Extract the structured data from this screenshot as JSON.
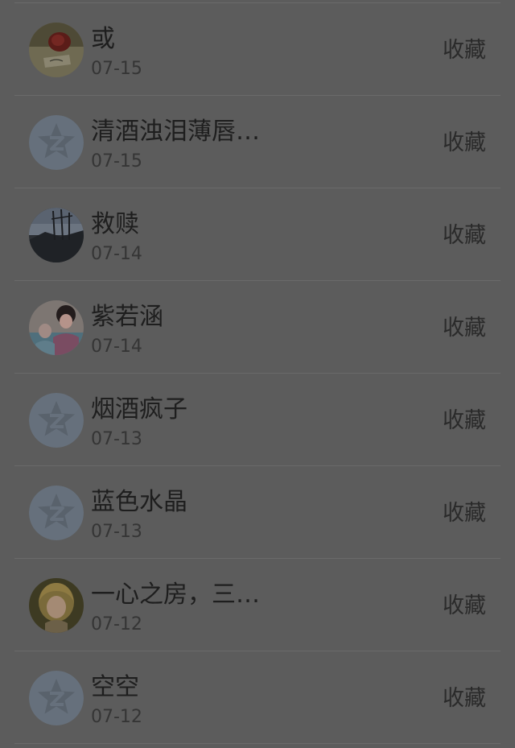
{
  "items": [
    {
      "name": "或",
      "date": "07-15",
      "action": "收藏",
      "avatar": "photo-rose"
    },
    {
      "name": "清酒浊泪薄唇…",
      "date": "07-15",
      "action": "收藏",
      "avatar": "default-qq"
    },
    {
      "name": "救赎",
      "date": "07-14",
      "action": "收藏",
      "avatar": "photo-landscape"
    },
    {
      "name": "紫若涵",
      "date": "07-14",
      "action": "收藏",
      "avatar": "photo-girl"
    },
    {
      "name": "烟酒疯子",
      "date": "07-13",
      "action": "收藏",
      "avatar": "default-qq"
    },
    {
      "name": "蓝色水晶",
      "date": "07-13",
      "action": "收藏",
      "avatar": "default-qq"
    },
    {
      "name": "一心之房，三…",
      "date": "07-12",
      "action": "收藏",
      "avatar": "photo-portrait"
    },
    {
      "name": "空空",
      "date": "07-12",
      "action": "收藏",
      "avatar": "default-qq"
    }
  ]
}
